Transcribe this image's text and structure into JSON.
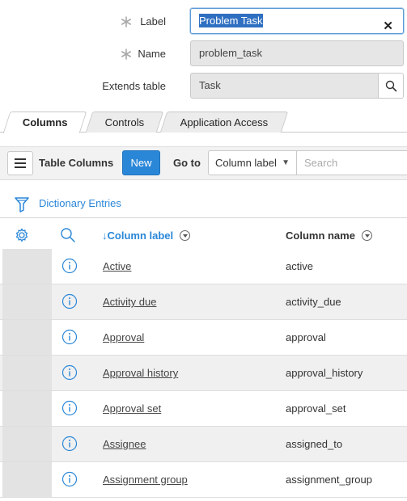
{
  "form": {
    "label": {
      "caption": "Label",
      "value": "Problem Task",
      "clear": "✕"
    },
    "name": {
      "caption": "Name",
      "value": "problem_task"
    },
    "extends": {
      "caption": "Extends table",
      "value": "Task"
    }
  },
  "tabs": [
    {
      "label": "Columns",
      "active": true
    },
    {
      "label": "Controls",
      "active": false
    },
    {
      "label": "Application Access",
      "active": false
    }
  ],
  "toolbar": {
    "title": "Table Columns",
    "new_label": "New",
    "goto_label": "Go to",
    "goto_selected": "Column label",
    "search_placeholder": "Search"
  },
  "filter": {
    "breadcrumb": "Dictionary Entries"
  },
  "table": {
    "headers": {
      "label": "↓Column label",
      "name": "Column name"
    },
    "rows": [
      {
        "label": "Active",
        "name": "active"
      },
      {
        "label": "Activity due",
        "name": "activity_due"
      },
      {
        "label": "Approval",
        "name": "approval"
      },
      {
        "label": "Approval history",
        "name": "approval_history"
      },
      {
        "label": "Approval set",
        "name": "approval_set"
      },
      {
        "label": "Assignee",
        "name": "assigned_to"
      },
      {
        "label": "Assignment group",
        "name": "assignment_group"
      }
    ]
  },
  "colors": {
    "accent": "#2a87d8",
    "selection": "#2f6fc1",
    "required": "#aaaaaa"
  }
}
